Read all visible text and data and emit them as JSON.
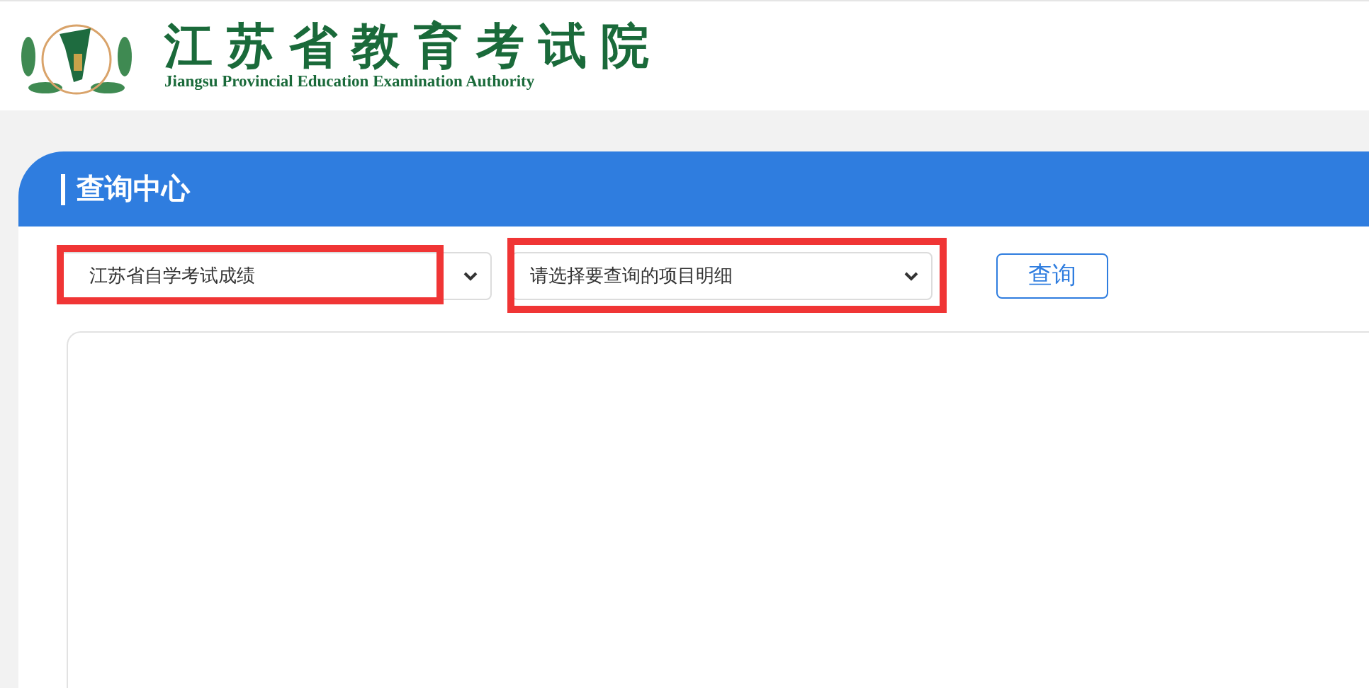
{
  "header": {
    "title": "江苏省教育考试院",
    "subtitle": "Jiangsu Provincial Education Examination Authority"
  },
  "panel": {
    "title": "查询中心"
  },
  "selects": [
    {
      "value": "江苏省自学考试成绩",
      "highlighted": true
    },
    {
      "value": "请选择要查询的项目明细",
      "highlighted": true
    }
  ],
  "button": {
    "label": "查询"
  }
}
